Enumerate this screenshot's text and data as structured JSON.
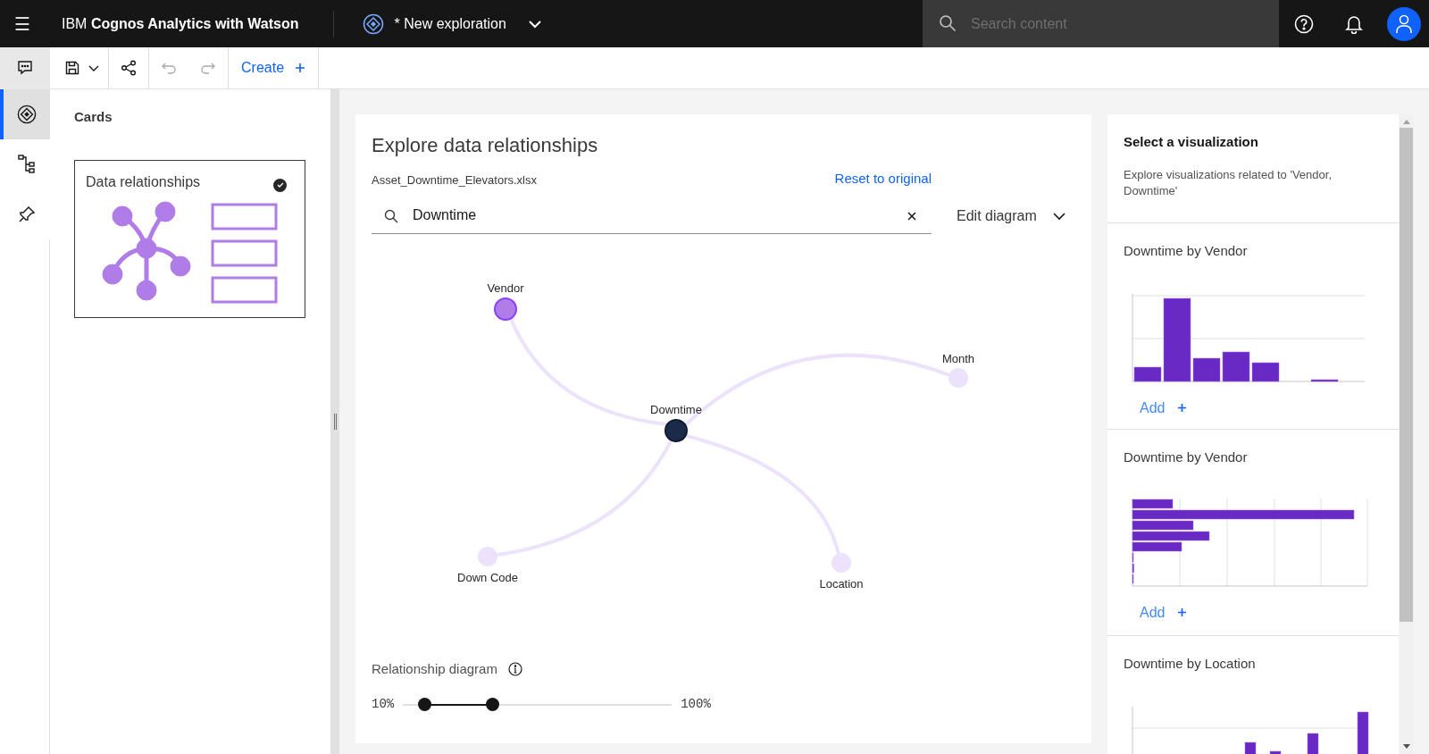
{
  "header": {
    "menu_icon": "☰",
    "product": "IBM **Cognos Analytics with Watson**",
    "exploration": "* New exploration",
    "search": {
      "placeholder": "Search content"
    }
  },
  "toolbar": {
    "create": "Create"
  },
  "rail_tabs": [
    {
      "selected": true
    },
    {
      "selected": false
    },
    {
      "selected": false
    }
  ],
  "cards_panel": {
    "title": "Cards",
    "cards": [
      {
        "label": "Data relationships",
        "checked": true
      }
    ]
  },
  "explore": {
    "title": "Explore data relationships",
    "file": "Asset_Downtime_Elevators.xlsx",
    "reset": "Reset to original",
    "search": {
      "value": "Downtime"
    },
    "edit": "Edit diagram",
    "nodes": [
      {
        "label": "Vendor",
        "kind": "field",
        "selected": true
      },
      {
        "label": "Downtime",
        "kind": "focus",
        "selected": false
      },
      {
        "label": "Month",
        "kind": "field",
        "selected": false
      },
      {
        "label": "Down Code",
        "kind": "field",
        "selected": false
      },
      {
        "label": "Location",
        "kind": "field",
        "selected": false
      }
    ],
    "slider": {
      "label": "Relationship diagram",
      "min": "10%",
      "max": "100%",
      "thumbs": [
        {
          "level": 0.08
        },
        {
          "level": 0.33
        }
      ]
    }
  },
  "visualizations": {
    "title": "Select a visualization",
    "description": "Explore visualizations related to 'Vendor, Downtime'",
    "items": [
      {
        "title": "Downtime by Vendor",
        "kind": "column",
        "add": "Add"
      },
      {
        "title": "Downtime by Vendor",
        "kind": "bar",
        "add": "Add"
      },
      {
        "title": "Downtime by Location",
        "kind": "column2"
      }
    ]
  }
}
